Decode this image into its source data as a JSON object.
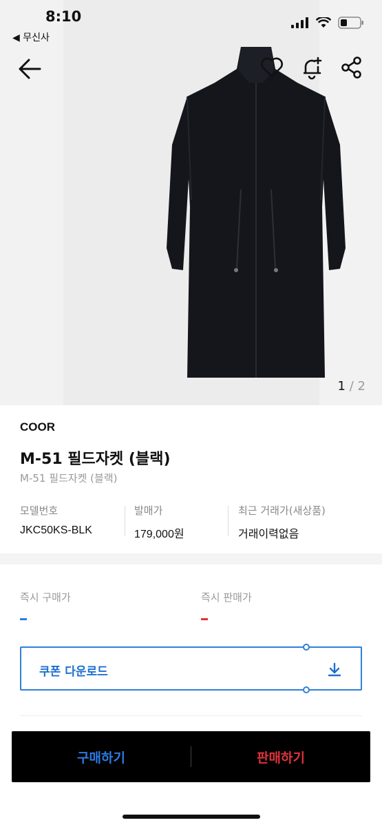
{
  "status_bar": {
    "time": "8:10",
    "back_app": "◀ 무신사"
  },
  "nav": {
    "back_icon": "arrow-left-icon",
    "like_icon": "heart-icon",
    "alert_icon": "bell-plus-icon",
    "share_icon": "share-icon"
  },
  "gallery": {
    "current": "1",
    "separator": "/",
    "total": "2"
  },
  "product": {
    "brand": "COOR",
    "title": "M-51 필드자켓 (블랙)",
    "subtitle": "M-51 필드자켓 (블랙)"
  },
  "specs": [
    {
      "label": "모델번호",
      "value": "JKC50KS-BLK"
    },
    {
      "label": "발매가",
      "value": "179,000원"
    },
    {
      "label": "최근 거래가(새상품)",
      "value": "거래이력없음"
    }
  ],
  "prices": {
    "buy_label": "즉시 구매가",
    "sell_label": "즉시 판매가"
  },
  "coupon": {
    "label": "쿠폰 다운로드"
  },
  "cta": {
    "buy": "구매하기",
    "sell": "판매하기"
  },
  "colors": {
    "buy": "#2c7be5",
    "sell": "#e0323a",
    "coupon": "#1e6fd0"
  }
}
